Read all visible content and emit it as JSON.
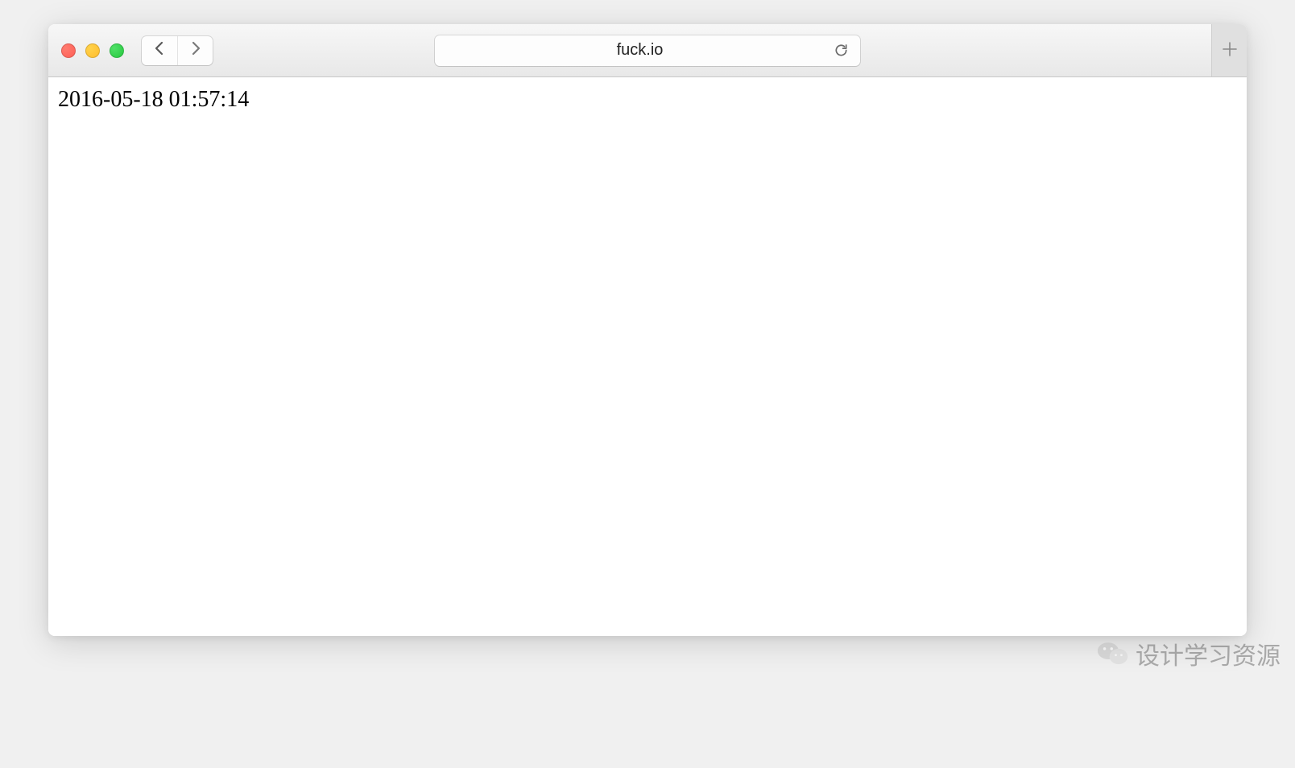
{
  "browser": {
    "url": "fuck.io"
  },
  "page": {
    "content_text": "2016-05-18 01:57:14"
  },
  "watermark": {
    "text": "设计学习资源"
  }
}
